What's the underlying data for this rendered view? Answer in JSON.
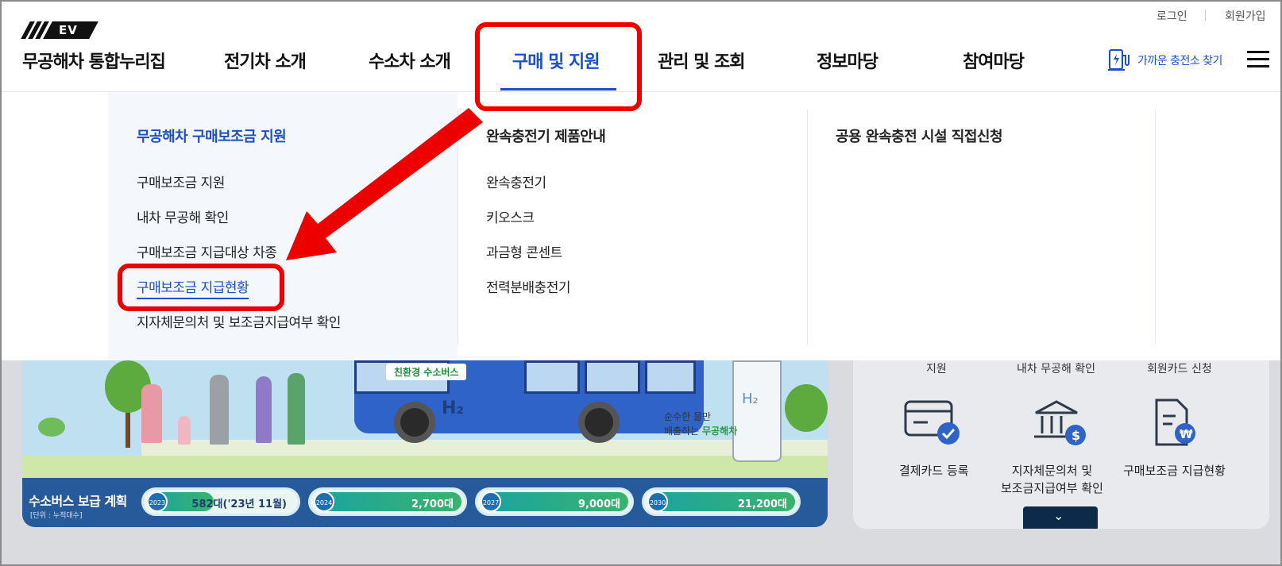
{
  "header": {
    "logo_text": "EV",
    "brand": "무공해차 통합누리집",
    "util_links": [
      "로그인",
      "회원가입"
    ],
    "gnb": [
      "전기차 소개",
      "수소차 소개",
      "구매 및 지원",
      "관리 및 조회",
      "정보마당",
      "참여마당"
    ],
    "active_gnb": "구매 및 지원",
    "charge_link": "가까운 충전소 찾기",
    "accent_color": "#1a4fc9"
  },
  "mega_menu": {
    "col1": {
      "title": "무공해차 구매보조금 지원",
      "links": [
        "구매보조금 지원",
        "내차 무공해 확인",
        "구매보조금 지급대상 차종",
        "구매보조금 지급현황",
        "지자체문의처 및 보조금지급여부 확인"
      ],
      "current": "구매보조금 지급현황"
    },
    "col2": {
      "title": "완속충전기 제품안내",
      "links": [
        "완속충전기",
        "키오스크",
        "과금형 콘센트",
        "전력분배충전기"
      ]
    },
    "col3": {
      "title": "공용 완속충전 시설 직접신청"
    }
  },
  "banner": {
    "bus_sign": "친환경 수소버스",
    "bus_mark": "H₂",
    "station_mark": "H₂",
    "slogan_line1": "순수한 물만",
    "slogan_line2_a": "배출하는 ",
    "slogan_line2_b": "무공해차",
    "plan_title": "수소버스 보급 계획",
    "plan_unit": "[단위 : 누적대수]",
    "plan": [
      {
        "year": "2023",
        "value": "582대('23년 11월)",
        "fill": 0.45
      },
      {
        "year": "2024",
        "value": "2,700대",
        "fill": 1.0
      },
      {
        "year": "2027",
        "value": "9,000대",
        "fill": 1.0
      },
      {
        "year": "2030",
        "value": "21,200대",
        "fill": 1.0
      }
    ]
  },
  "quick_panel": {
    "top_labels": [
      "지원",
      "내차 무공해 확인",
      "회원카드 신청"
    ],
    "items": [
      {
        "label": "결제카드 등록",
        "icon": "card-check-icon"
      },
      {
        "label_line1": "지자체문의처 및",
        "label_line2": "보조금지급여부 확인",
        "icon": "bank-dollar-icon"
      },
      {
        "label": "구매보조금 지급현황",
        "icon": "document-won-icon"
      }
    ],
    "more_icon": "chevron-down-icon"
  },
  "annotation_color": "#ee0000"
}
